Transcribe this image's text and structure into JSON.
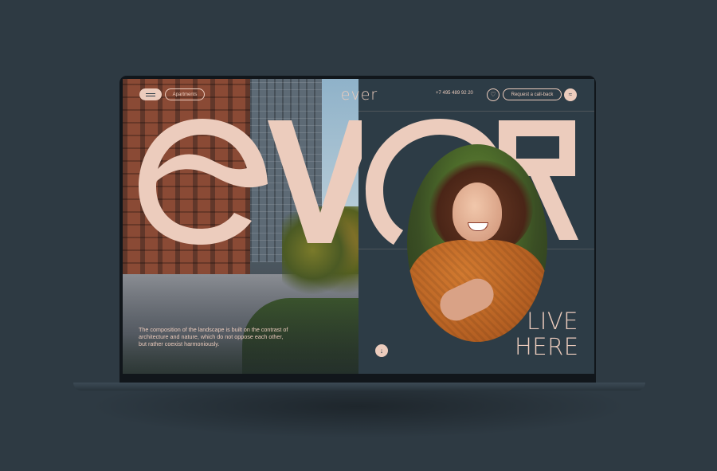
{
  "header": {
    "menu_icon": "hamburger-icon",
    "apartments_label": "Apartments",
    "logo": "ever",
    "phone": "+7 495 489 92 20",
    "favorite_icon": "heart-icon",
    "callback_label": "Request a call-back",
    "brand_icon": "wave-icon"
  },
  "hero": {
    "big_word": "ever",
    "description": "The composition of the landscape is built on the contrast of architecture and nature, which do not oppose each other, but rather coexist harmoniously.",
    "tagline_line1": "LIVE",
    "tagline_line2": "HERE",
    "scroll_icon": "arrow-down-icon"
  },
  "colors": {
    "background": "#2e3a43",
    "panel": "#2d3c46",
    "accent": "#ecccbd"
  }
}
